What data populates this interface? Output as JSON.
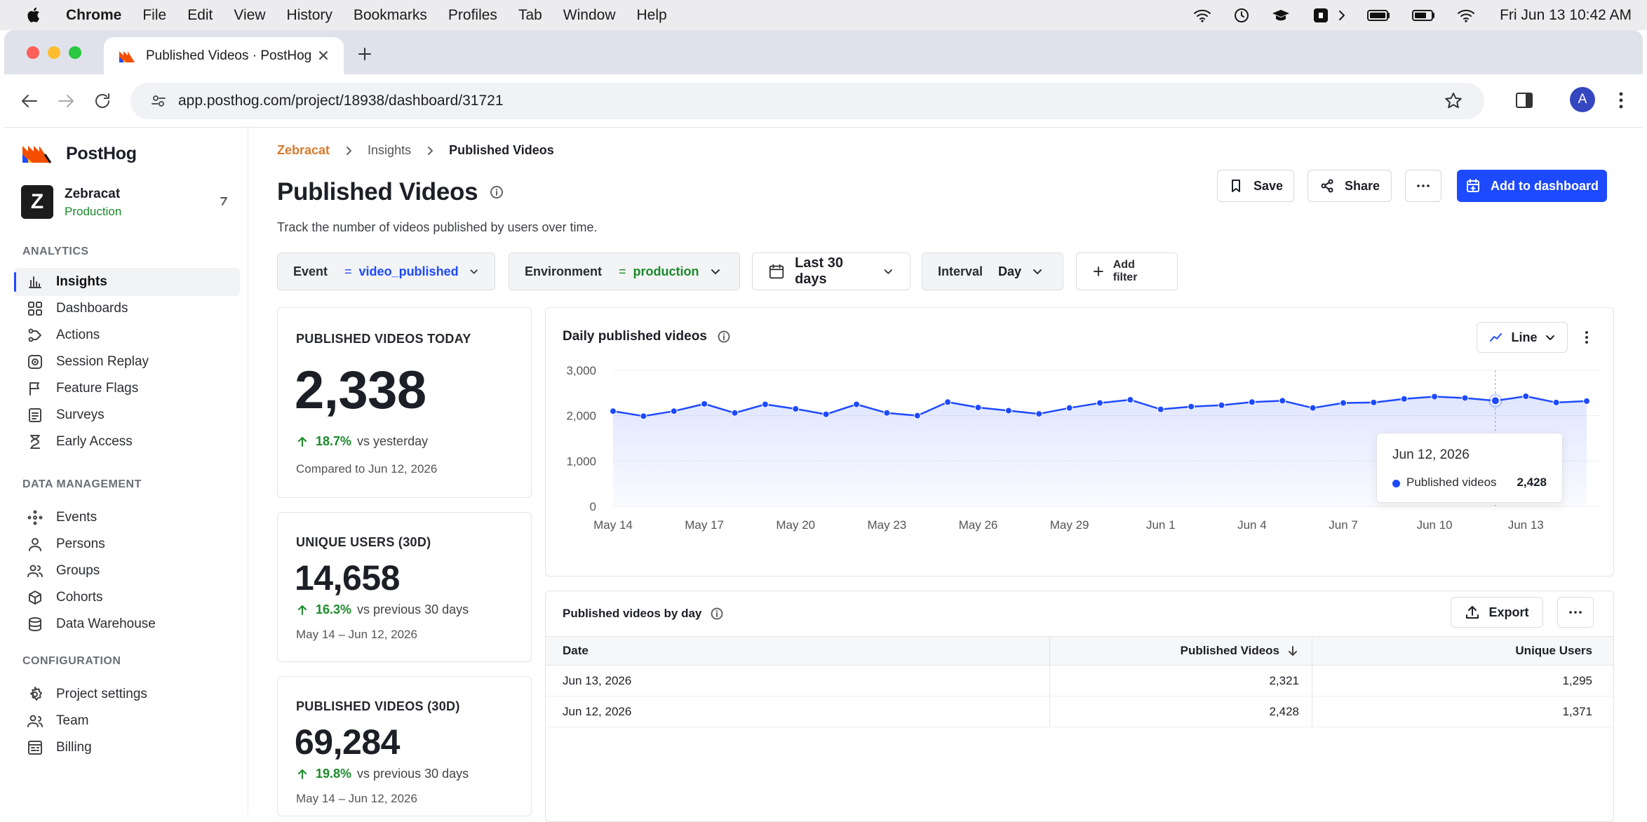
{
  "menubar": {
    "items": [
      "Chrome",
      "File",
      "Edit",
      "View",
      "History",
      "Bookmarks",
      "Profiles",
      "Tab",
      "Window",
      "Help"
    ],
    "clock": "Fri Jun 13  10:42 AM",
    "status_icons": [
      "wifi-icon",
      "clock-icon",
      "graduation-cap-icon",
      "app-icon",
      "chevron-right-icon",
      "battery-icon",
      "battery-icon",
      "wifi-icon"
    ]
  },
  "browser": {
    "tab_title": "Published Videos · PostHog",
    "url": "app.posthog.com/project/18938/dashboard/31721",
    "avatar_letter": "A"
  },
  "sidebar": {
    "brand": "PostHog",
    "project_initial": "Z",
    "project_name": "Zebracat",
    "project_env": "Production",
    "sections": [
      {
        "title": "ANALYTICS",
        "items": [
          {
            "label": "Insights",
            "icon": "insights-icon",
            "active": true
          },
          {
            "label": "Dashboards",
            "icon": "dashboards-icon"
          },
          {
            "label": "Actions",
            "icon": "actions-icon"
          },
          {
            "label": "Session Replay",
            "icon": "session-replay-icon"
          },
          {
            "label": "Feature Flags",
            "icon": "flag-icon"
          },
          {
            "label": "Surveys",
            "icon": "surveys-icon"
          },
          {
            "label": "Early Access",
            "icon": "early-access-icon"
          }
        ]
      },
      {
        "title": "DATA MANAGEMENT",
        "items": [
          {
            "label": "Events",
            "icon": "events-icon"
          },
          {
            "label": "Persons",
            "icon": "person-icon"
          },
          {
            "label": "Groups",
            "icon": "groups-icon"
          },
          {
            "label": "Cohorts",
            "icon": "cohorts-icon"
          },
          {
            "label": "Data Warehouse",
            "icon": "database-icon"
          }
        ]
      },
      {
        "title": "CONFIGURATION",
        "items": [
          {
            "label": "Project settings",
            "icon": "gear-icon"
          },
          {
            "label": "Team",
            "icon": "team-icon"
          },
          {
            "label": "Billing",
            "icon": "billing-icon"
          }
        ]
      }
    ]
  },
  "page": {
    "breadcrumbs": [
      "Zebracat",
      "Insights",
      "Published Videos"
    ],
    "title": "Published Videos",
    "description": "Track the number of videos published by users over time.",
    "actions": {
      "save": "Save",
      "share": "Share",
      "add_to_dashboard": "Add to dashboard"
    }
  },
  "filters": {
    "event": {
      "label": "Event",
      "op": "=",
      "value": "video_published"
    },
    "environment": {
      "label": "Environment",
      "op": "=",
      "value": "production"
    },
    "date_range": "Last 30 days",
    "interval": {
      "label": "Interval",
      "value": "Day"
    },
    "add_filter": "Add filter"
  },
  "stats": [
    {
      "title": "PUBLISHED VIDEOS TODAY",
      "value": "2,338",
      "delta": "18.7%",
      "delta_text": "vs yesterday",
      "caption": "Compared to Jun 12, 2026"
    },
    {
      "title": "UNIQUE USERS (30D)",
      "value": "14,658",
      "delta": "16.3%",
      "delta_text": "vs previous 30 days",
      "caption": "May 14 – Jun 12, 2026"
    },
    {
      "title": "PUBLISHED VIDEOS (30D)",
      "value": "69,284",
      "delta": "19.8%",
      "delta_text": "vs previous 30 days",
      "caption": "May 14 – Jun 12, 2026"
    }
  ],
  "chart_panel": {
    "title": "Daily published videos",
    "type_button": "Line",
    "tooltip": {
      "date": "Jun 12, 2026",
      "series": "Published videos",
      "value": "2,428"
    }
  },
  "chart_data": {
    "type": "line",
    "title": "Daily published videos",
    "x": [
      "May 14",
      "May 15",
      "May 16",
      "May 17",
      "May 18",
      "May 19",
      "May 20",
      "May 21",
      "May 22",
      "May 23",
      "May 24",
      "May 25",
      "May 26",
      "May 27",
      "May 28",
      "May 29",
      "May 30",
      "May 31",
      "Jun 1",
      "Jun 2",
      "Jun 3",
      "Jun 4",
      "Jun 5",
      "Jun 6",
      "Jun 7",
      "Jun 8",
      "Jun 9",
      "Jun 10",
      "Jun 11",
      "Jun 12",
      "Jun 13"
    ],
    "series": [
      {
        "name": "Published videos",
        "values": [
          2100,
          1990,
          2100,
          2260,
          2060,
          2250,
          2150,
          2030,
          2250,
          2060,
          2000,
          2300,
          2180,
          2110,
          2040,
          2170,
          2280,
          2350,
          2140,
          2200,
          2230,
          2300,
          2330,
          2170,
          2280,
          2290,
          2370,
          2420,
          2390,
          2330,
          2428,
          2290,
          2321
        ]
      }
    ],
    "x_ticks": [
      "May 14",
      "May 17",
      "May 20",
      "May 23",
      "May 26",
      "May 29",
      "Jun 1",
      "Jun 4",
      "Jun 7",
      "Jun 10",
      "Jun 13"
    ],
    "y_ticks": [
      "0",
      "1,000",
      "2,000",
      "3,000"
    ],
    "ylim": [
      0,
      3000
    ],
    "grid": true,
    "color": "#1d4aff"
  },
  "table": {
    "title": "Published videos by day",
    "export": "Export",
    "columns": [
      "Date",
      "Published Videos",
      "Unique Users"
    ],
    "rows": [
      {
        "date": "Jun 13, 2026",
        "videos": "2,321",
        "users": "1,295"
      },
      {
        "date": "Jun 12, 2026",
        "videos": "2,428",
        "users": "1,371"
      }
    ]
  },
  "colors": {
    "accent": "#1d4aff",
    "positive": "#1a8a2a",
    "brand_orange": "#d97a2c"
  }
}
